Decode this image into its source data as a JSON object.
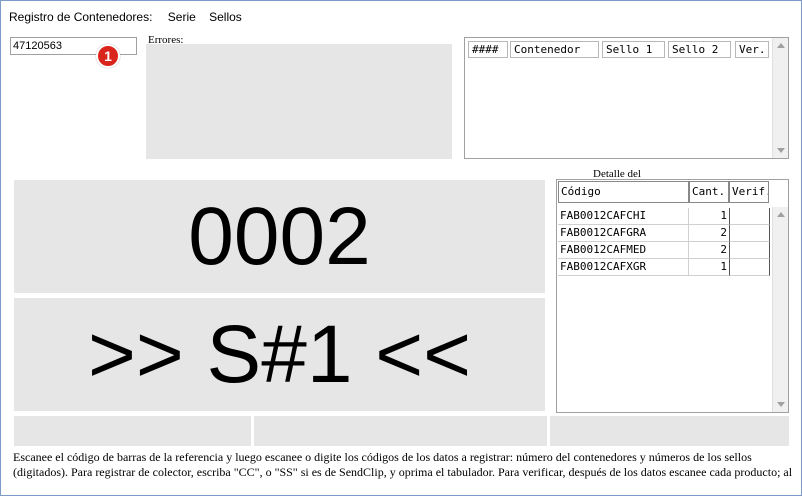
{
  "menu": {
    "title": "Registro de Contenedores:",
    "items": [
      "Serie",
      "Sellos"
    ]
  },
  "scan_input": {
    "value": "47120563"
  },
  "badge": {
    "text": "1",
    "color": "#d9251c"
  },
  "errors": {
    "label": "Errores:"
  },
  "container_grid": {
    "headers": [
      "####",
      "Contenedor",
      "Sello 1",
      "Sello 2",
      "Ver."
    ]
  },
  "detail": {
    "label": "Detalle del",
    "headers": {
      "code": "Código",
      "qty": "Cant.",
      "ver": "Verif."
    },
    "rows": [
      {
        "code": "FAB0012CAFCHI",
        "qty": "1",
        "ver": ""
      },
      {
        "code": "FAB0012CAFGRA",
        "qty": "2",
        "ver": ""
      },
      {
        "code": "FAB0012CAFMED",
        "qty": "2",
        "ver": ""
      },
      {
        "code": "FAB0012CAFXGR",
        "qty": "1",
        "ver": ""
      }
    ]
  },
  "display": {
    "count": "0002",
    "seal": ">> S#1 <<"
  },
  "instructions": {
    "text": "Escanee el código de barras de la referencia y luego escanee o digite los códigos de los datos a registrar: número del contenedores y números de los sellos (digitados). Para registrar de colector, escriba \"CC\", o \"SS\" si es de SendClip, y oprima el tabulador. Para verificar, después de los datos escanee cada producto; al"
  },
  "colors": {
    "panel_bg": "#e6e6e6",
    "window_border": "#7a9cc6"
  }
}
